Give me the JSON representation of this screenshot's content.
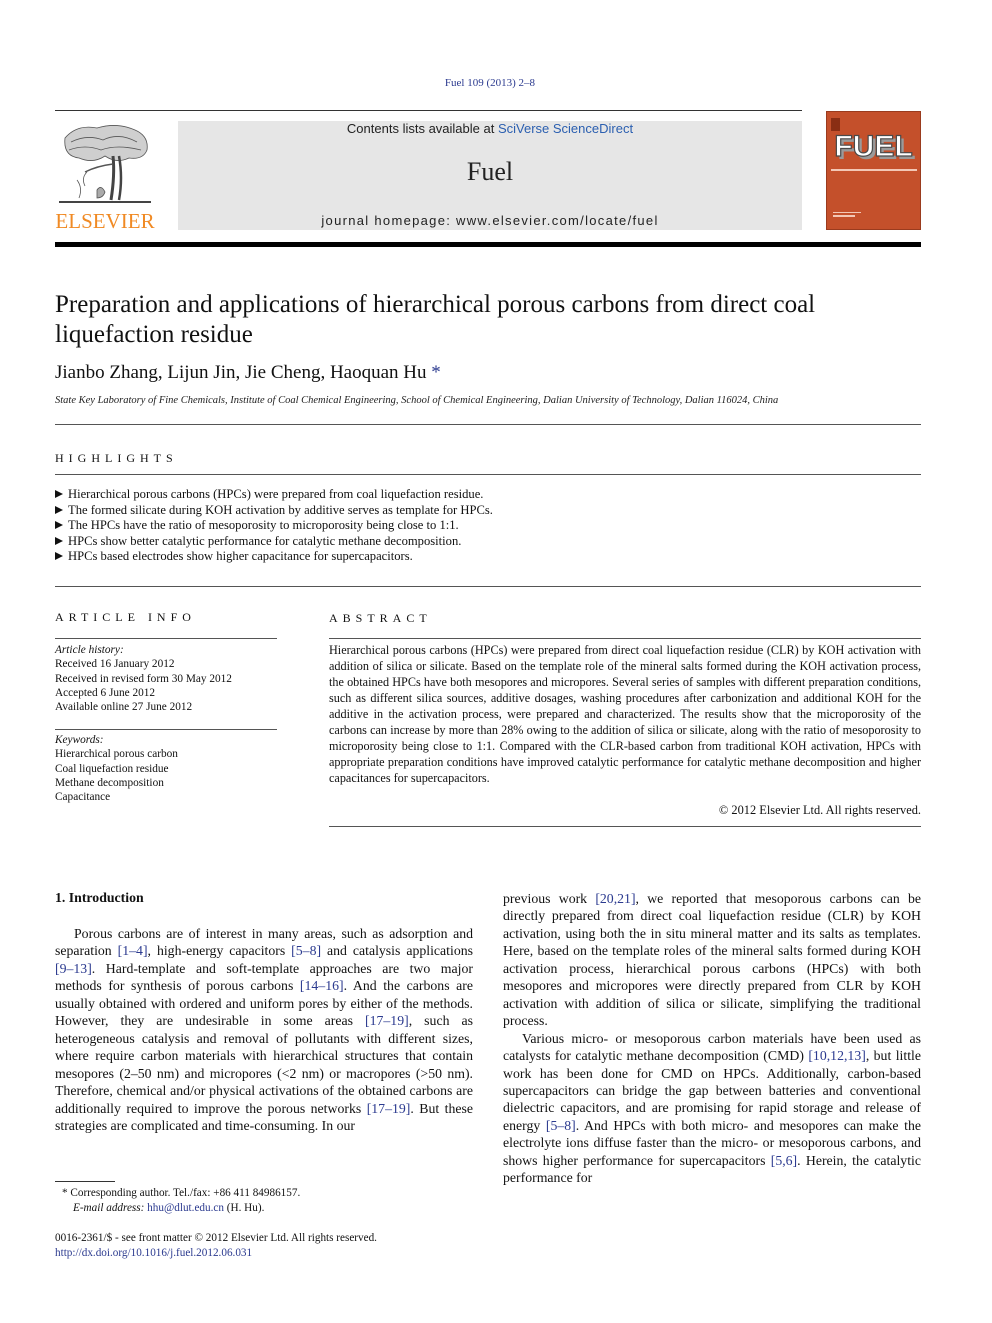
{
  "header": {
    "journal_ref": "Fuel 109 (2013) 2–8",
    "contents_prefix": "Contents lists available at ",
    "contents_link": "SciVerse ScienceDirect",
    "journal_name": "Fuel",
    "homepage": "journal homepage: www.elsevier.com/locate/fuel",
    "publisher_logo_text": "ELSEVIER",
    "cover_title": "FUEL"
  },
  "article": {
    "title": "Preparation and applications of hierarchical porous carbons from direct coal liquefaction residue",
    "authors": "Jianbo Zhang, Lijun Jin, Jie Cheng, Haoquan Hu",
    "corresponding_mark": "*",
    "affiliation": "State Key Laboratory of Fine Chemicals, Institute of Coal Chemical Engineering, School of Chemical Engineering, Dalian University of Technology, Dalian 116024, China"
  },
  "highlights": {
    "heading": "HIGHLIGHTS",
    "items": [
      "Hierarchical porous carbons (HPCs) were prepared from coal liquefaction residue.",
      "The formed silicate during KOH activation by additive serves as template for HPCs.",
      "The HPCs have the ratio of mesoporosity to microporosity being close to 1:1.",
      "HPCs show better catalytic performance for catalytic methane decomposition.",
      "HPCs based electrodes show higher capacitance for supercapacitors."
    ]
  },
  "article_info": {
    "heading": "ARTICLE INFO",
    "history_label": "Article history:",
    "history": [
      "Received 16 January 2012",
      "Received in revised form 30 May 2012",
      "Accepted 6 June 2012",
      "Available online 27 June 2012"
    ],
    "keywords_label": "Keywords:",
    "keywords": [
      "Hierarchical porous carbon",
      "Coal liquefaction residue",
      "Methane decomposition",
      "Capacitance"
    ]
  },
  "abstract": {
    "heading": "ABSTRACT",
    "text": "Hierarchical porous carbons (HPCs) were prepared from direct coal liquefaction residue (CLR) by KOH activation with addition of silica or silicate. Based on the template role of the mineral salts formed during the KOH activation process, the obtained HPCs have both mesopores and micropores. Several series of samples with different preparation conditions, such as different silica sources, additive dosages, washing procedures after carbonization and additional KOH for the additive in the activation process, were prepared and characterized. The results show that the microporosity of the carbons can increase by more than 28% owing to the addition of silica or silicate, along with the ratio of mesoporosity to microporosity being close to 1:1. Compared with the CLR-based carbon from traditional KOH activation, HPCs with appropriate preparation conditions have improved catalytic performance for catalytic methane decomposition and higher capacitances for supercapacitors.",
    "copyright": "© 2012 Elsevier Ltd. All rights reserved."
  },
  "body": {
    "intro_heading": "1. Introduction",
    "left": {
      "s1": "Porous carbons are of interest in many areas, such as adsorption and separation ",
      "r1": "[1–4]",
      "s2": ", high-energy capacitors ",
      "r2": "[5–8]",
      "s3": " and catalysis applications ",
      "r3": "[9–13]",
      "s4": ". Hard-template and soft-template approaches are two major methods for synthesis of porous carbons ",
      "r4": "[14–16]",
      "s5": ". And the carbons are usually obtained with ordered and uniform pores by either of the methods. However, they are undesirable in some areas ",
      "r5": "[17–19]",
      "s6": ", such as heterogeneous catalysis and removal of pollutants with different sizes, where require carbon materials with hierarchical structures that contain mesopores (2–50 nm) and micropores (<2 nm) or macropores (>50 nm). Therefore, chemical and/or physical activations of the obtained carbons are additionally required to improve the porous networks ",
      "r6": "[17–19]",
      "s7": ". But these strategies are complicated and time-consuming. In our"
    },
    "right": {
      "p1_s1": "previous work ",
      "p1_r1": "[20,21]",
      "p1_s2": ", we reported that mesoporous carbons can be directly prepared from direct coal liquefaction residue (CLR) by KOH activation, using both the in situ mineral matter and its salts as templates. Here, based on the template roles of the mineral salts formed during KOH activation process, hierarchical porous carbons (HPCs) with both mesopores and micropores were directly prepared from CLR by KOH activation with addition of silica or silicate, simplifying the traditional process.",
      "p2_s1": "Various micro- or mesoporous carbon materials have been used as catalysts for catalytic methane decomposition (CMD) ",
      "p2_r1": "[10,12,13]",
      "p2_s2": ", but little work has been done for CMD on HPCs. Additionally, carbon-based supercapacitors can bridge the gap between batteries and conventional dielectric capacitors, and are promising for rapid storage and release of energy ",
      "p2_r2": "[5–8]",
      "p2_s3": ". And HPCs with both micro- and mesopores can make the electrolyte ions diffuse faster than the micro- or mesoporous carbons, and shows higher performance for supercapacitors ",
      "p2_r3": "[5,6]",
      "p2_s4": ". Herein, the catalytic performance for"
    }
  },
  "footnote": {
    "mark": "*",
    "corresponding": " Corresponding author. Tel./fax: +86 411 84986157.",
    "email_label": "E-mail address: ",
    "email": "hhu@dlut.edu.cn",
    "email_suffix": " (H. Hu)."
  },
  "issn": {
    "line": "0016-2361/$ - see front matter © 2012 Elsevier Ltd. All rights reserved.",
    "doi": "http://dx.doi.org/10.1016/j.fuel.2012.06.031"
  },
  "colors": {
    "link": "#2b3a8f",
    "elsevier_orange": "#f08a24",
    "cover": "#c4502b",
    "masthead_bg": "#e6e6e6"
  }
}
